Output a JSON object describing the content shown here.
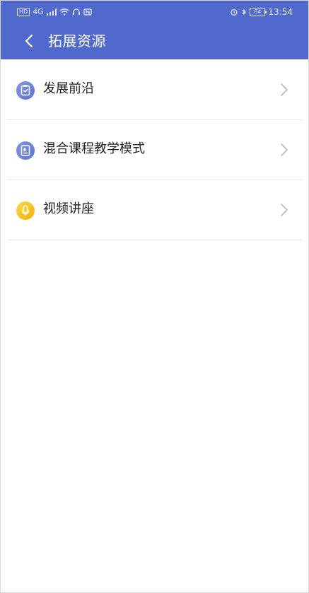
{
  "status_bar": {
    "left_text": "HD",
    "network_text": "4G",
    "battery_level": "64",
    "time": "13:54"
  },
  "header": {
    "title": "拓展资源"
  },
  "list_items": [
    {
      "label": "发展前沿",
      "icon": "clipboard-icon",
      "color": "#6b7fdf"
    },
    {
      "label": "混合课程教学模式",
      "icon": "document-icon",
      "color": "#6b7fdf"
    },
    {
      "label": "视频讲座",
      "icon": "microphone-icon",
      "color": "#f5bc12"
    }
  ],
  "colors": {
    "header_bg": "#5169cc",
    "divider": "#e6e6e6"
  }
}
